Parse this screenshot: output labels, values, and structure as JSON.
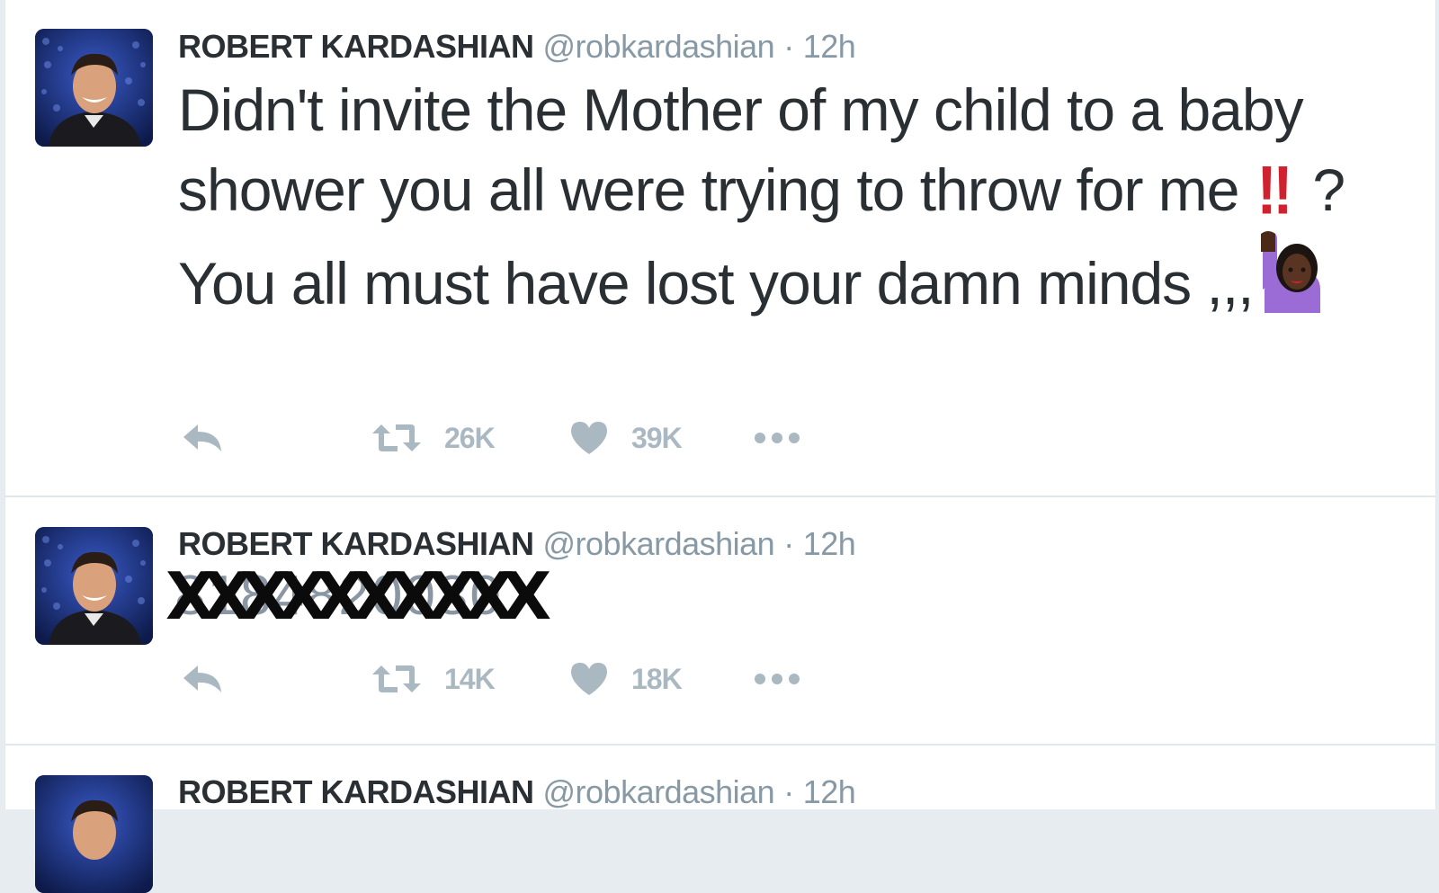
{
  "tweets": [
    {
      "author": {
        "name": "ROBERT KARDASHIAN",
        "handle": "@robkardashian",
        "separator": "·",
        "time": "12h"
      },
      "text_line_1": "Didn't invite the Mother of my child to a baby shower you all were trying to throw for me",
      "bang": "‼",
      "text_line_2": "? You all must have lost your damn minds ,,,",
      "emoji": "raising-hand-woman-dark-skin",
      "actions": {
        "reply_icon": "reply-icon",
        "retweet_icon": "retweet-icon",
        "retweets": "26K",
        "like_icon": "heart-icon",
        "likes": "39K",
        "more_icon": "more-icon"
      }
    },
    {
      "author": {
        "name": "ROBERT KARDASHIAN",
        "handle": "@robkardashian",
        "separator": "·",
        "time": "12h"
      },
      "redacted_underlay": "8184820030",
      "redacted_overlay": "XXXXXXXXXX",
      "actions": {
        "reply_icon": "reply-icon",
        "retweet_icon": "retweet-icon",
        "retweets": "14K",
        "like_icon": "heart-icon",
        "likes": "18K",
        "more_icon": "more-icon"
      }
    },
    {
      "author": {
        "name": "ROBERT KARDASHIAN",
        "handle": "@robkardashian",
        "separator": "·",
        "time": "12h"
      }
    }
  ],
  "colors": {
    "text": "#292f33",
    "secondary": "#8899a6",
    "action_gray": "#aab8c2",
    "divider": "#e1e8ed",
    "bang_red": "#d0222e",
    "emoji_purple": "#9b6bd6"
  }
}
